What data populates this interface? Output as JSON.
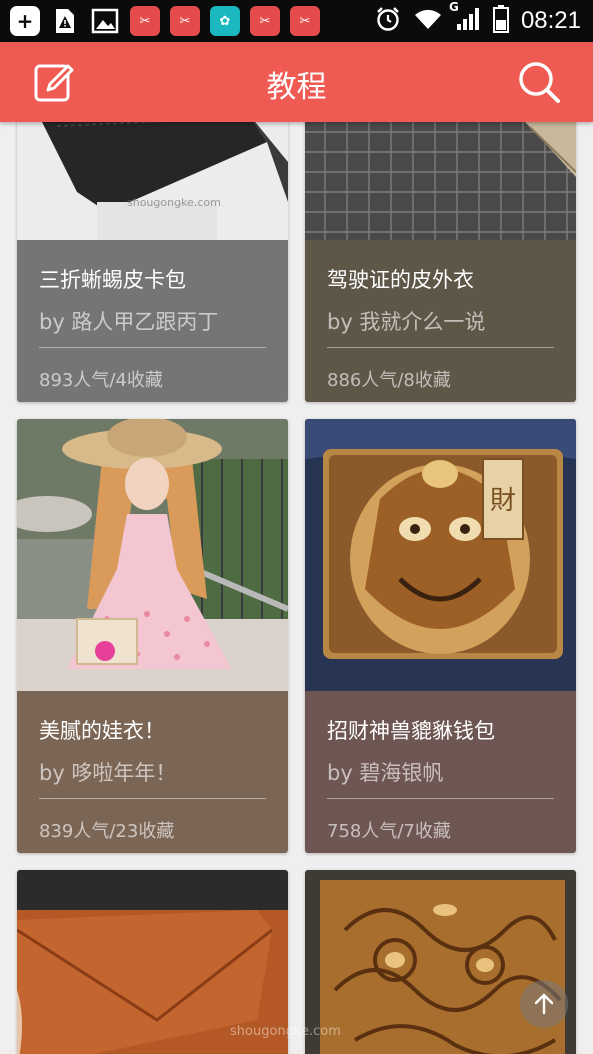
{
  "status_bar": {
    "time": "08:21",
    "network_label": "G"
  },
  "app_bar": {
    "title": "教程"
  },
  "cards": [
    {
      "title": "三折蜥蜴皮卡包",
      "author": "by 路人甲乙跟丙丁",
      "stats": "893人气/4收藏",
      "bg": "#757575"
    },
    {
      "title": "驾驶证的皮外衣",
      "author": "by 我就介么一说",
      "stats": "886人气/8收藏",
      "bg": "#5e5647"
    },
    {
      "title": "美腻的娃衣！",
      "author": "by 哆啦年年！",
      "stats": "839人气/23收藏",
      "bg": "#7b6656"
    },
    {
      "title": "招财神兽貔貅钱包",
      "author": "by 碧海银帆",
      "stats": "758人气/7收藏",
      "bg": "#6e5652"
    }
  ],
  "watermarks": {
    "card1": "shougongke.com",
    "bottom": "shougongke.com"
  }
}
